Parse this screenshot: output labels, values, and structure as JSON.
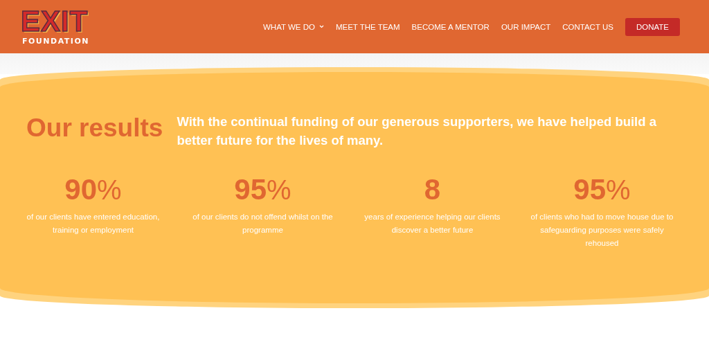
{
  "logo": {
    "title": "EXIT",
    "subtitle": "FOUNDATION"
  },
  "nav": [
    {
      "label": "WHAT WE DO",
      "has_dropdown": true
    },
    {
      "label": "MEET THE TEAM",
      "has_dropdown": false
    },
    {
      "label": "BECOME A MENTOR",
      "has_dropdown": false
    },
    {
      "label": "OUR IMPACT",
      "has_dropdown": false
    },
    {
      "label": "CONTACT US",
      "has_dropdown": false
    }
  ],
  "donate_button": "DONATE",
  "results": {
    "heading": "Our results",
    "intro": "With the continual funding of our generous supporters, we have helped build a better future for the lives of many.",
    "stats": [
      {
        "number": "90",
        "unit": "%",
        "caption": "of our clients have entered education, training or employment"
      },
      {
        "number": "95",
        "unit": "%",
        "caption": "of our clients do not offend whilst on the programme"
      },
      {
        "number": "8",
        "caption": "years of experience helping our clients discover a better future"
      },
      {
        "number": "95",
        "unit": "%",
        "caption": "of clients who had to move house due to safeguarding purposes were safely rehoused"
      }
    ]
  }
}
